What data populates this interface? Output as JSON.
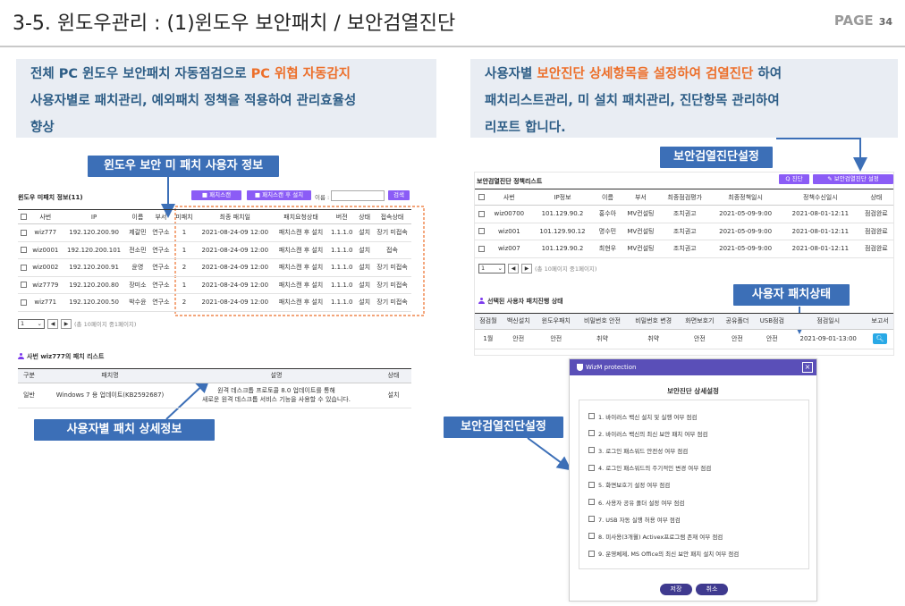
{
  "header": {
    "title": "3-5. 윈도우관리 : (1)윈도우 보안패치 / 보안검열진단",
    "page_label": "PAGE",
    "page_num": "34"
  },
  "left_desc": {
    "l1a": "전체 PC 윈도우 보안패치 자동점검으로 ",
    "l1hl": "PC 위협 자동감지",
    "l2": "사용자별로 패치관리, 예외패치 정책을 적용하여 관리효율성",
    "l3": "향상"
  },
  "right_desc": {
    "l1a": "사용자별 ",
    "l1hl": "보안진단 상세항목을 설정하여 검열진단",
    "l1b": " 하여",
    "l2": "패치리스트관리, 미 설치 패치관리, 진단항목 관리하여",
    "l3": "리포트 합니다."
  },
  "labels": {
    "unpatched_info": "윈도우 보안 미 패치 사용자 정보",
    "user_patch_detail": "사용자별 패치 상세정보",
    "audit_setting_top": "보안검열진단설정",
    "user_patch_status": "사용자 패치상태",
    "audit_setting_left": "보안검열진단설정"
  },
  "left_panel": {
    "title": "윈도우 미패치 정보(11)",
    "btn_scan": "■ 패치스캔",
    "btn_scan_install": "■ 패치스캔 후 설치",
    "name_label": "이름 :",
    "search": "검색",
    "columns": [
      "사번",
      "IP",
      "이름",
      "부서",
      "미패치",
      "최종 패치일",
      "패치요청상태",
      "버전",
      "상태",
      "접속상태"
    ],
    "rows": [
      [
        "wiz777",
        "192.120.200.90",
        "제갈민",
        "연구소",
        "1",
        "2021-08-24-09 12:00",
        "패치스캔 후 설치",
        "1.1.1.0",
        "설치",
        "장기 미접속"
      ],
      [
        "wiz0001",
        "192.120.200.101",
        "전소민",
        "연구소",
        "1",
        "2021-08-24-09 12:00",
        "패치스캔 후 설치",
        "1.1.1.0",
        "설치",
        "접속"
      ],
      [
        "wiz0002",
        "192.120.200.91",
        "윤영",
        "연구소",
        "2",
        "2021-08-24-09 12:00",
        "패치스캔 후 설치",
        "1.1.1.0",
        "설치",
        "장기 미접속"
      ],
      [
        "wiz7779",
        "192.120.200.80",
        "장미소",
        "연구소",
        "1",
        "2021-08-24-09 12:00",
        "패치스캔 후 설치",
        "1.1.1.0",
        "설치",
        "장기 미접속"
      ],
      [
        "wiz771",
        "192.120.200.50",
        "박수윤",
        "연구소",
        "2",
        "2021-08-24-09 12:00",
        "패치스캔 후 설치",
        "1.1.1.0",
        "설치",
        "장기 미접속"
      ]
    ],
    "pager_value": "1",
    "pager_text": "(총 10페이지 중1페이지)",
    "patchlist_title": "사번 wiz777의 패치 리스트",
    "patch_columns": [
      "구분",
      "패치명",
      "설명",
      "상태"
    ],
    "patch_row": {
      "type": "일반",
      "name": "Windows 7 용 업데이트(KB2592687)",
      "desc1": "원격 데스크톱 프로토콜 8.0 업데이트를 통해",
      "desc2": "새로운 원격 데스크톱 서비스 기능을 사용할 수 있습니다.",
      "status": "설치"
    }
  },
  "right_panel": {
    "title": "보안검열진단 정책리스트",
    "btn_diag": "Q 진단",
    "btn_setting": "✎ 보안검열진단 설정",
    "columns": [
      "사번",
      "IP정보",
      "이름",
      "부서",
      "최종점검평가",
      "최종정책일시",
      "정책수신일시",
      "상태"
    ],
    "rows": [
      [
        "wiz00700",
        "101.129.90.2",
        "홍수아",
        "MV컨설팅",
        "조치권고",
        "2021-05-09-9:00",
        "2021-08-01-12:11",
        "점검완료"
      ],
      [
        "wiz001",
        "101.129.90.12",
        "명수민",
        "MV컨설팅",
        "조치권고",
        "2021-05-09-9:00",
        "2021-08-01-12:11",
        "점검완료"
      ],
      [
        "wiz007",
        "101.129.90.2",
        "최현우",
        "MV컨설팅",
        "조치권고",
        "2021-05-09-9:00",
        "2021-08-01-12:11",
        "점검완료"
      ]
    ],
    "pager_value": "1",
    "pager_text": "(총 10페이지 중1페이지)",
    "selected_title": "선택된 사용자 패치진행 상태",
    "status_columns": [
      "점검월",
      "백신설치",
      "윈도우패치",
      "비밀번호 안전",
      "비밀번호 변경",
      "화면보호기",
      "공유폴더",
      "USB점검",
      "점검일시",
      "보고서"
    ],
    "status_row": [
      "1월",
      "안전",
      "안전",
      "취약",
      "취약",
      "안전",
      "안전",
      "안전",
      "2021-09-01-13:00"
    ]
  },
  "modal": {
    "header": "WizM protection",
    "title": "보안진단 상세설정",
    "items": [
      "1. 바이러스 백신 설치 및 실행 여부 점검",
      "2. 바이러스 백신의 최신 보안 패치 여부 점검",
      "3. 로그인 패스워드 안전성 여부 점검",
      "4. 로그인 패스워드의 주기적인 변경 여부 점검",
      "5. 화면보호기 설정 여부 점검",
      "6. 사용자 공유 폴더 설정 여부 점검",
      "7. USB 자동 실행 허용 여부 점검",
      "8. 미사용(3개월) Activex프로그램 존재 여부 점검",
      "9. 운영체제, MS Office의 최신 보안 패치 설치 여부 점검"
    ],
    "save": "저장",
    "cancel": "취소"
  },
  "colors": {
    "accent_blue": "#3c6fb7",
    "highlight_orange": "#ec6f2a",
    "purple": "#8b5cf6",
    "modal_header": "#5a4fb8",
    "dashed_orange": "#ec6f2a",
    "search_cyan": "#29a9e6"
  },
  "icons": {
    "user": "person-icon",
    "close": "close-icon",
    "search": "search-icon",
    "shield": "shield-icon"
  }
}
